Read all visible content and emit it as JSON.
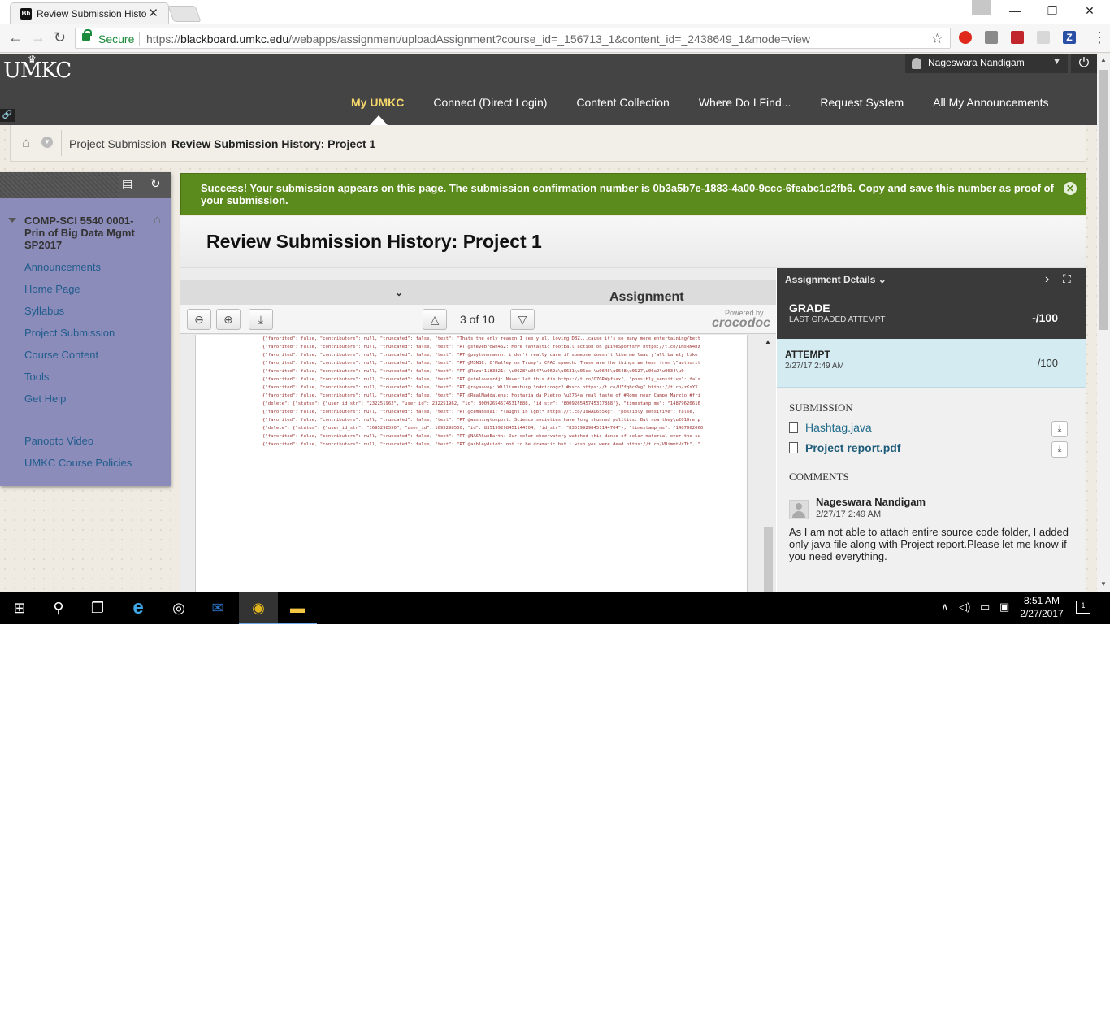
{
  "browser": {
    "tab_title": "Review Submission History",
    "tab_favicon": "Bb",
    "secure_label": "Secure",
    "url_scheme": "https://",
    "url_host": "blackboard.umkc.edu",
    "url_path": "/webapps/assignment/uploadAssignment?course_id=_156713_1&content_id=_2438649_1&mode=view"
  },
  "header": {
    "logo": "UMKC",
    "user_name": "Nageswara Nandigam",
    "nav": [
      "My UMKC",
      "Connect (Direct Login)",
      "Content Collection",
      "Where Do I Find...",
      "Request System",
      "All My Announcements"
    ],
    "active_nav": "My UMKC"
  },
  "breadcrumb": {
    "items": [
      "Project Submission",
      "Review Submission History: Project 1"
    ]
  },
  "course_menu": {
    "title": "COMP-SCI 5540 0001-Prin of Big Data Mgmt SP2017",
    "links": [
      "Announcements",
      "Home Page",
      "Syllabus",
      "Project Submission",
      "Course Content",
      "Tools",
      "Get Help"
    ],
    "extra_links": [
      "Panopto Video",
      "UMKC Course Policies"
    ]
  },
  "banner": {
    "text": "Success! Your submission appears on this page. The submission confirmation number is 0b3a5b7e-1883-4a00-9ccc-6feabc1c2fb6. Copy and save this number as proof of your submission."
  },
  "page_title": "Review Submission History: Project 1",
  "viewer": {
    "instructions_label": "Assignment Instructions",
    "page_indicator": "3 of 10",
    "powered_by": "Powered by",
    "brand": "crocodoc",
    "doc_lines": [
      "{\"favorited\": false, \"contributors\": null, \"truncated\": false, \"text\": \"Thats the only reason I see y'all loving DBZ...cause it's so many more entertaining/bett",
      "{\"favorited\": false, \"contributors\": null, \"truncated\": false, \"text\": \"RT @stevebrown462: More fantastic football action on @LiveSportsFM https://t.co/1HsRN4hz",
      "{\"favorited\": false, \"contributors\": null, \"truncated\": false, \"text\": \"RT @paytonnnaenn: i don't really care if someone doesn't like me lmao y'all barely like",
      "{\"favorited\": false, \"contributors\": null, \"truncated\": false, \"text\": \"RT @MSNBC: O'Malley on Trump's CPAC speech: These are the things we hear from \\\"authorit",
      "{\"favorited\": false, \"contributors\": null, \"truncated\": false, \"text\": \"RT @Reza41183821: \\u0628\\u0647\\u062a\\u0631\\u06cc \\u0646\\u0648\\u0627\\u06a9\\u0634\\u0",
      "{\"favorited\": false, \"contributors\": null, \"truncated\": false, \"text\": \"RT @stelovesrdj: Never let this die https://t.co/OZGRWpfsax\", \"possibly_sensitive\": fals",
      "{\"favorited\": false, \"contributors\": null, \"truncated\": false, \"text\": \"RT @royaavoy: Williamsburg.\\n#ricobgr2 #vsco https://t.co/UZfqbcKWgI https://t.co/zKsYX",
      "{\"favorited\": false, \"contributors\": null, \"truncated\": false, \"text\": \"RT @RealMaddalena: Hostaria da Pietro \\u2764a real taste of #Rome near Campo Marzio #fri",
      "{\"delete\": {\"status\": {\"user_id_str\": \"232251962\", \"user_id\": 232251962, \"id\": 800926545745317888, \"id_str\": \"800926545745317888\"}, \"timestamp_ms\": \"14879620616",
      "{\"favorited\": false, \"contributors\": null, \"truncated\": false, \"text\": \"RT @cemahshai: *laughs in lgbt* https://t.co/uswAD6S5kg\", \"possibly_sensitive\": false,",
      "{\"favorited\": false, \"contributors\": null, \"truncated\": false, \"text\": \"RT @washingtonpost: Science societies have long shunned politics. But now they\\u2019re p",
      "{\"delete\": {\"status\": {\"user_id_str\": \"1695298550\", \"user_id\": 1695298550, \"id\": 835199298451144704, \"id_str\": \"835199298451144704\"}, \"timestamp_ms\": \"1487962066",
      "{\"favorited\": false, \"contributors\": null, \"truncated\": false, \"text\": \"RT @NASASunEarth: Our solar observatory watched this dance of solar material over the su",
      "{\"favorited\": false, \"contributors\": null, \"truncated\": false, \"text\": \"RT @ashleyduiet: not to be dramatic but i wish you were dead https://t.co/VNimmtVcTt\", \""
    ]
  },
  "details": {
    "header": "Assignment Details",
    "grade_label": "GRADE",
    "last_graded_label": "LAST GRADED ATTEMPT",
    "grade_value": "-/100",
    "attempt_label": "ATTEMPT",
    "attempt_date": "2/27/17 2:49 AM",
    "attempt_value": "/100",
    "submission_label": "SUBMISSION",
    "files": [
      "Hashtag.java",
      "Project report.pdf"
    ],
    "comments_label": "COMMENTS",
    "comment_author": "Nageswara Nandigam",
    "comment_date": "2/27/17 2:49 AM",
    "comment_text": "As I am not able to attach entire source code folder, I added only java file along with Project report.Please let me know if you need everything."
  },
  "taskbar": {
    "time": "8:51 AM",
    "date": "2/27/2017",
    "notifications": "1"
  },
  "colors": {
    "nav_bg": "#444444",
    "nav_active": "#f4d66b",
    "banner_bg": "#5b8a1d",
    "course_menu_bg": "#8c8cbb",
    "attempt_bg": "#d4ebf2"
  }
}
